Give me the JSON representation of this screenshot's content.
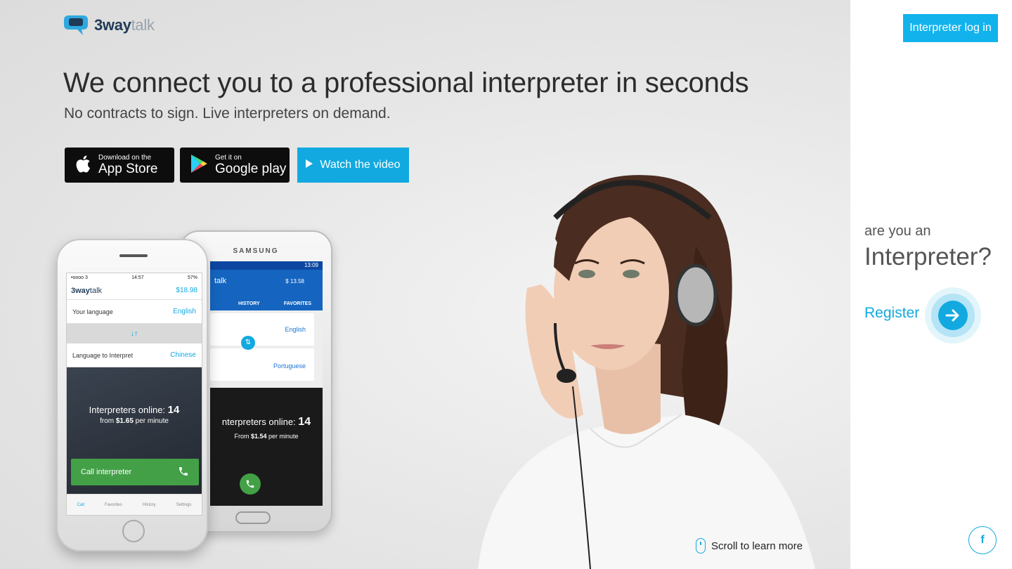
{
  "brand": {
    "name_bold": "3way",
    "name_light": "talk"
  },
  "hero": {
    "headline": "We connect you to a professional interpreter in seconds",
    "subhead": "No contracts to sign. Live interpreters on demand."
  },
  "buttons": {
    "app_store_small": "Download on the",
    "app_store_big": "App Store",
    "google_small": "Get it on",
    "google_big": "Google play",
    "video": "Watch the video"
  },
  "phone_front": {
    "status_left": "•oooo 3",
    "time": "14:57",
    "battery": "57%",
    "balance": "$18.98",
    "your_language_label": "Your language",
    "your_language_value": "English",
    "interpret_label": "Language to Interpret",
    "interpret_value": "Chinese",
    "online_label": "Interpreters online:",
    "online_count": "14",
    "price_prefix": "from",
    "price": "$1.65",
    "price_suffix": "per minute",
    "call_button": "Call interpreter",
    "tabs": [
      "Call",
      "Favorites",
      "History",
      "Settings"
    ]
  },
  "phone_back": {
    "maker": "SAMSUNG",
    "time": "13:09",
    "balance": "$ 13.58",
    "tab_history": "HISTORY",
    "tab_favorites": "FAVORITES",
    "lang1": "English",
    "lang2": "Portuguese",
    "online_label": "nterpreters online:",
    "online_count": "14",
    "price_prefix": "From",
    "price": "$1.54",
    "price_suffix": "per minute"
  },
  "scroll_hint": "Scroll to learn more",
  "side": {
    "login": "Interpreter log in",
    "are_you": "are you an",
    "interpreter": "Interpreter?",
    "register": "Register"
  },
  "colors": {
    "accent": "#12a9e0",
    "login_bg": "#12b3ec",
    "call_green": "#43a047"
  },
  "icons": [
    "apple-icon",
    "google-play-icon",
    "play-icon",
    "mouse-icon",
    "arrow-right-icon",
    "facebook-icon"
  ]
}
